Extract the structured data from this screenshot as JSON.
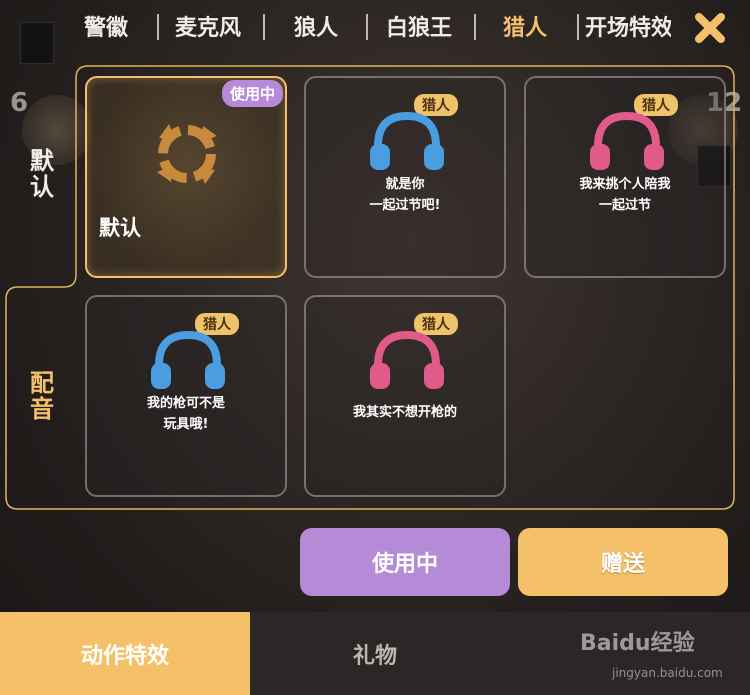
{
  "top_tabs": [
    "警徽",
    "麦克风",
    "狼人",
    "白狼王",
    "猎人",
    "开场特效"
  ],
  "active_tab_index": 4,
  "seats": {
    "left_number": "6",
    "right_number": "12"
  },
  "side_labels": {
    "default": "默认",
    "dubbing": "配音"
  },
  "cards": [
    {
      "title": "默认",
      "badge": "使用中",
      "icon": "default-cycle-icon",
      "selected": true
    },
    {
      "role": "猎人",
      "text_line1": "就是你",
      "text_line2": "一起过节吧!",
      "icon": "headphone-icon",
      "color": "#4a9de0"
    },
    {
      "role": "猎人",
      "text_line1": "我来挑个人陪我",
      "text_line2": "一起过节",
      "icon": "headphone-icon",
      "color": "#e05a8a"
    },
    {
      "role": "猎人",
      "text_line1": "我的枪可不是",
      "text_line2": "玩具哦!",
      "icon": "headphone-icon",
      "color": "#4a9de0"
    },
    {
      "role": "猎人",
      "text_line1": "我其实不想开枪的",
      "text_line2": "",
      "icon": "headphone-icon",
      "color": "#e05a8a"
    }
  ],
  "buttons": {
    "in_use": "使用中",
    "gift": "赠送"
  },
  "bottom_nav": [
    "动作特效",
    "礼物",
    ""
  ],
  "watermark": {
    "text": "Baidu经验",
    "sub": "jingyan.baidu.com"
  },
  "colors": {
    "accent": "#f5c06a",
    "purple": "#b58ad6",
    "blue": "#4a9de0",
    "pink": "#e05a8a"
  }
}
